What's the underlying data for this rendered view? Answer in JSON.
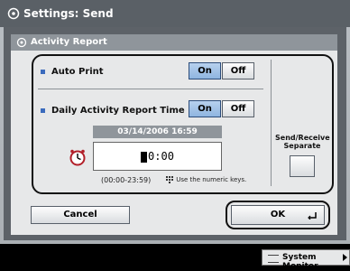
{
  "header": {
    "title": "Settings: Send",
    "icon": "settings-icon"
  },
  "panel": {
    "title": "Activity Report",
    "icon": "settings-icon"
  },
  "auto_print": {
    "label": "Auto Print",
    "on": "On",
    "off": "Off",
    "selected": "On"
  },
  "daily_report": {
    "label": "Daily Activity Report Time",
    "on": "On",
    "off": "Off",
    "selected": "On"
  },
  "datetime": "03/14/2006 16:59",
  "time_input": {
    "value": "0:00"
  },
  "range": "(00:00-23:59)",
  "hint": "Use the numeric keys.",
  "send_receive_separate": {
    "label": "Send/Receive Separate"
  },
  "buttons": {
    "cancel": "Cancel",
    "ok": "OK"
  },
  "status_bar": {
    "system_monitor": "System Monitor"
  },
  "colors": {
    "selected_button": "#9bbce3",
    "accent_square": "#3b6bbd"
  }
}
